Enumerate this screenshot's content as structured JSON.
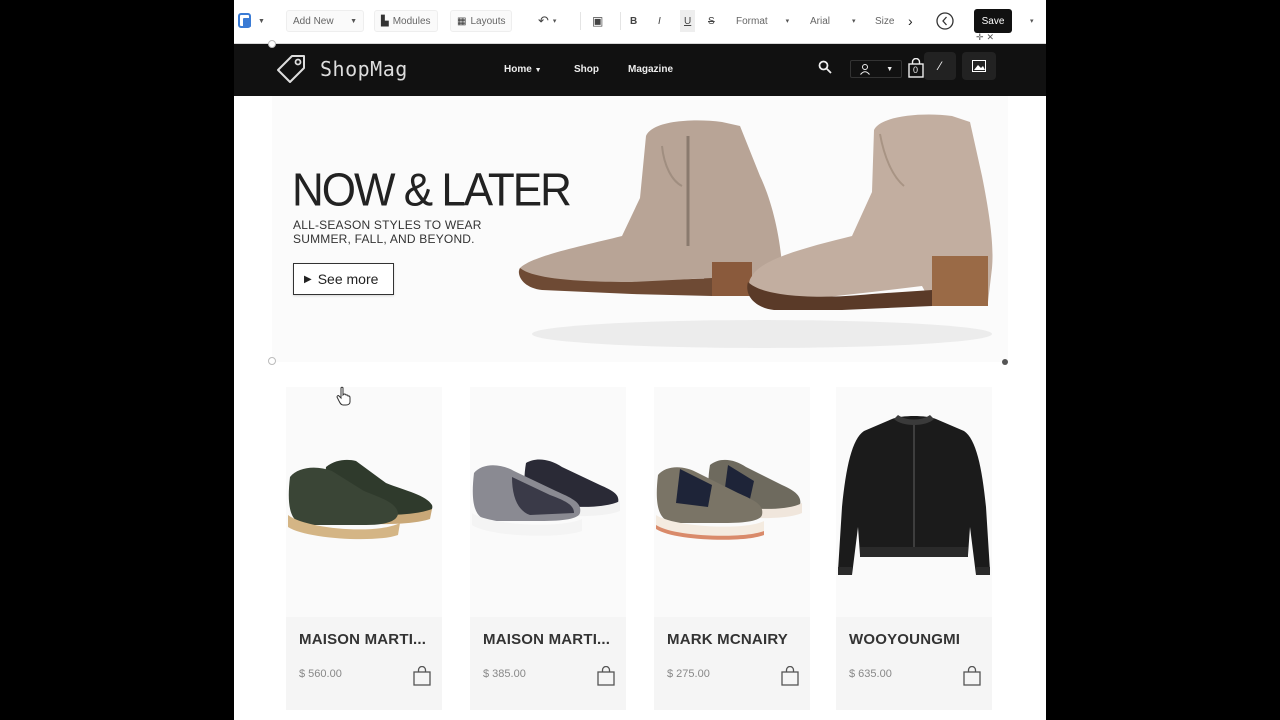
{
  "toolbar": {
    "add_new": "Add New",
    "modules": "Modules",
    "layouts": "Layouts",
    "format": "Format",
    "font": "Arial",
    "size": "Size",
    "save": "Save"
  },
  "header": {
    "logo_text": "ShopMag",
    "nav": [
      {
        "label": "Home"
      },
      {
        "label": "Shop"
      },
      {
        "label": "Magazine"
      }
    ],
    "cart_count": "0"
  },
  "hero": {
    "title": "NOW & LATER",
    "subtitle": "ALL-SEASON STYLES TO WEAR SUMMER, FALL, AND BEYOND.",
    "cta": "See more"
  },
  "products": [
    {
      "name": "MAISON MARTI...",
      "price": "$ 560.00"
    },
    {
      "name": "MAISON MARTI...",
      "price": "$ 385.00"
    },
    {
      "name": "MARK MCNAIRY",
      "price": "$ 275.00"
    },
    {
      "name": "WOOYOUNGMI",
      "price": "$ 635.00"
    }
  ],
  "colors": {
    "header_bg": "#111111",
    "save_bg": "#111111",
    "page_bg": "#ffffff"
  }
}
